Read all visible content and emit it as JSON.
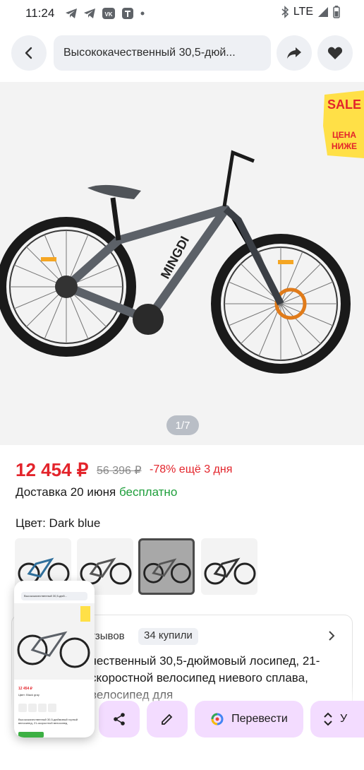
{
  "status_bar": {
    "time": "11:24",
    "network": "LTE"
  },
  "header": {
    "back_icon": "chevron-left-icon",
    "title": "Высококачественный 30,5-дюй...",
    "share_icon": "share-arrow-icon",
    "favorite_icon": "heart-icon"
  },
  "gallery": {
    "counter": "1/7",
    "sale_badge": {
      "line1": "SALE",
      "line2": "ЦЕНА",
      "line3": "НИЖЕ"
    }
  },
  "product": {
    "price": "12 454 ₽",
    "old_price": "56 396 ₽",
    "discount": "-78% ещё 3 дня",
    "delivery_label": "Доставка 20 июня",
    "delivery_free": "бесплатно",
    "color_label": "Цвет: Dark blue",
    "swatches_count": 4,
    "selected_swatch_index": 2,
    "reviews_text": "тзывов",
    "bought_text": "34 купили",
    "description": "чественный 30,5-дюймовый лосипед, 21-скоростной велосипед ниевого сплава, велосипед для"
  },
  "actions": {
    "share_icon": "share-icon",
    "edit_icon": "pencil-icon",
    "translate_icon": "lens-translate-icon",
    "translate_label": "Перевести",
    "expand_icon": "expand-vertical-icon",
    "extra_label": "У"
  },
  "screenshot_thumb": {
    "mini_title": "Высококачественный 30,5-дюй...",
    "mini_price": "12 454 ₽",
    "mini_color": "Цвет: Black gray",
    "mini_desc": "Высококачественный 30,5-дюймовый горный велосипед, 21-скоростной велосипед"
  },
  "colors": {
    "price_red": "#e3242b",
    "free_green": "#1d9e3a",
    "pill_bg": "#eef0f4",
    "action_bg": "#f3dcff"
  }
}
